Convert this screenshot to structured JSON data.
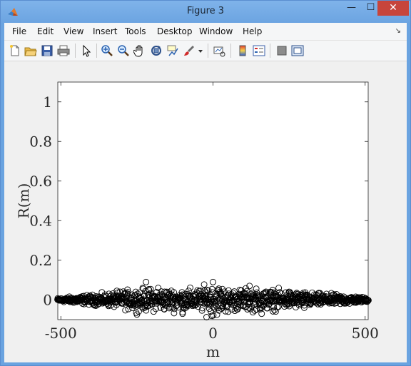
{
  "window": {
    "title": "Figure 3",
    "minimize_glyph": "—",
    "maximize_glyph": "☐",
    "close_glyph": "✕",
    "titlebar_color": "#6ca4e1",
    "close_color": "#c7453b"
  },
  "menubar": {
    "items": [
      "File",
      "Edit",
      "View",
      "Insert",
      "Tools",
      "Desktop",
      "Window",
      "Help"
    ],
    "dock_glyph": "↘"
  },
  "toolbar": {
    "buttons": [
      "new-figure-icon",
      "open-file-icon",
      "save-icon",
      "print-icon",
      "select-arrow-icon",
      "zoom-in-icon",
      "zoom-out-icon",
      "pan-hand-icon",
      "rotate-3d-icon",
      "data-cursor-icon",
      "brush-icon",
      "brush-dropdown-icon",
      "link-plot-icon",
      "colorbar-icon",
      "legend-icon",
      "hide-plot-tools-icon",
      "show-plot-tools-icon"
    ]
  },
  "chart_data": {
    "type": "scatter",
    "marker": "open-circle",
    "marker_color": "#000000",
    "xlabel": "m",
    "ylabel": "R(m)",
    "xlim": [
      -510,
      510
    ],
    "ylim": [
      -0.1,
      1.1
    ],
    "xticks": [
      -500,
      0,
      500
    ],
    "xtick_labels": [
      "-500",
      "0",
      "500"
    ],
    "yticks": [
      0,
      0.2,
      0.4,
      0.6,
      0.8,
      1
    ],
    "ytick_labels": [
      "0",
      "0.2",
      "0.4",
      "0.6",
      "0.8",
      "1"
    ],
    "grid": false,
    "series": [
      {
        "x_range": [
          -511,
          511
        ],
        "n_points": 1023,
        "description_points": [
          {
            "x": -500,
            "y": 0.0
          },
          {
            "x": -400,
            "y": 0.01
          },
          {
            "x": -300,
            "y": 0.02
          },
          {
            "x": -220,
            "y": 0.09
          },
          {
            "x": -180,
            "y": 0.06
          },
          {
            "x": -100,
            "y": -0.07
          },
          {
            "x": -20,
            "y": 0.05
          },
          {
            "x": 0,
            "y": 0.09
          },
          {
            "x": 50,
            "y": -0.06
          },
          {
            "x": 120,
            "y": 0.07
          },
          {
            "x": 160,
            "y": -0.07
          },
          {
            "x": 250,
            "y": 0.04
          },
          {
            "x": 300,
            "y": -0.04
          },
          {
            "x": 400,
            "y": 0.02
          },
          {
            "x": 500,
            "y": 0.0
          }
        ],
        "envelope_max": [
          [
            -511,
            0.01
          ],
          [
            -450,
            0.02
          ],
          [
            -350,
            0.035
          ],
          [
            -250,
            0.06
          ],
          [
            -150,
            0.06
          ],
          [
            -50,
            0.06
          ],
          [
            0,
            0.09
          ],
          [
            50,
            0.06
          ],
          [
            150,
            0.06
          ],
          [
            250,
            0.05
          ],
          [
            350,
            0.035
          ],
          [
            450,
            0.025
          ],
          [
            511,
            0.01
          ]
        ]
      }
    ]
  }
}
